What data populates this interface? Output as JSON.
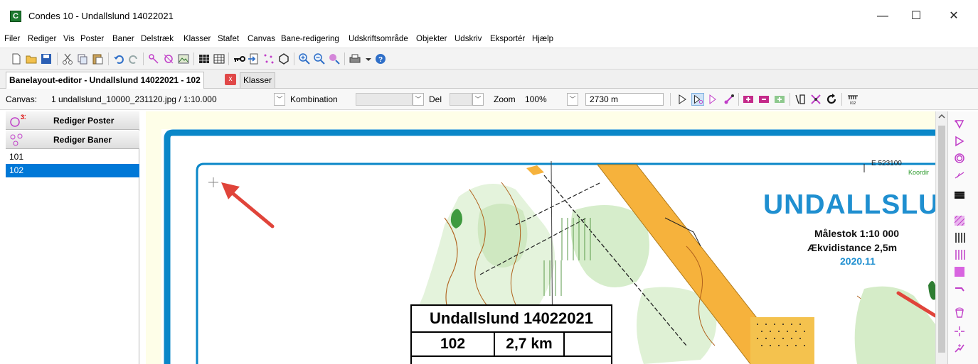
{
  "window": {
    "title": "Condes 10 - Undallslund 14022021",
    "app_icon": "C",
    "minimize": "—",
    "maximize": "☐",
    "close": "✕"
  },
  "menu": [
    "Filer",
    "Rediger",
    "Vis",
    "Poster",
    "Baner",
    "Delstræk",
    "Klasser",
    "Stafet",
    "Canvas",
    "Bane-redigering",
    "Udskriftsområde",
    "Objekter",
    "Udskriv",
    "Eksportér",
    "Hjælp"
  ],
  "tabs": {
    "active": "Banelayout-editor - Undallslund 14022021 - 102",
    "close": "x",
    "second": "Klasser"
  },
  "canvasbar": {
    "canvas_label": "Canvas:",
    "canvas_value": "1 undallslund_10000_231120.jpg  / 1:10.000",
    "kombination_label": "Kombination",
    "del_label": "Del",
    "zoom_label": "Zoom",
    "zoom_value": "100%",
    "length_value": "2730 m"
  },
  "left_panel": {
    "rediger_poster": "Rediger Poster",
    "rediger_poster_badge": "31",
    "rediger_baner": "Rediger Baner",
    "courses": [
      "101",
      "102"
    ],
    "selected_course": "102"
  },
  "map": {
    "map_title": "UNDALLSLUN",
    "scale_text": "Målestok 1:10 000",
    "contour_text": "Ækvidistance 2,5m",
    "year_text": "2020.11",
    "coord_text": "E 523100",
    "coord_label": "Koordir",
    "control_table": {
      "title": "Undallslund 14022021",
      "course": "102",
      "length": "2,7 km"
    }
  },
  "colors": {
    "selection_blue": "#0078d7",
    "map_frame_blue": "#0a87c8",
    "map_title_blue": "#1f8fd0",
    "course_purple": "#c03ec8",
    "arrow_red": "#e0443a"
  }
}
